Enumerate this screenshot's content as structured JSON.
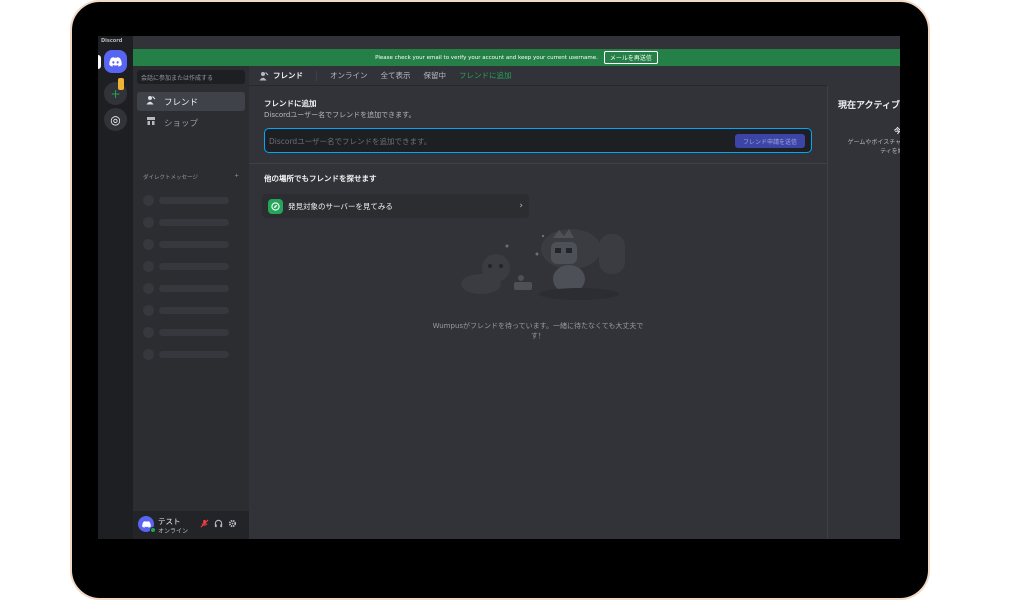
{
  "app": {
    "name": "Discord"
  },
  "banner": {
    "message": "Please check your email to verify your account and keep your current username.",
    "button_label": "メールを再送信"
  },
  "rail": {
    "add_server_symbol": "+",
    "explore_symbol": "◎"
  },
  "sidebar": {
    "search_placeholder": "会話に参加または作成する",
    "items": [
      {
        "label": "フレンド",
        "icon": "friends-icon"
      },
      {
        "label": "ショップ",
        "icon": "shop-icon"
      }
    ],
    "dm_header": "ダイレクトメッセージ",
    "dm_add": "+"
  },
  "user": {
    "name": "テスト",
    "status": "オンライン"
  },
  "header": {
    "title": "フレンド",
    "tabs": [
      "オンライン",
      "全て表示",
      "保留中"
    ],
    "add_friend_tab": "フレンドに追加"
  },
  "add_friend": {
    "title": "フレンドに追加",
    "description": "Discordユーザー名でフレンドを追加できます。",
    "input_placeholder": "Discordユーザー名でフレンドを追加できます。",
    "input_value": "",
    "send_button": "フレンド申請を送信"
  },
  "other_places": {
    "title": "他の場所でもフレンドを探せます",
    "explore_label": "発見対象のサーバーを見てみる"
  },
  "empty_state": {
    "text": "Wumpusがフレンドを待っています。一緒に待たなくても大丈夫です！"
  },
  "right_panel": {
    "title": "現在アクティブ",
    "subtitle": "今は",
    "description": "ゲームやボイスチャンネルでアクティビティを始めると"
  },
  "colors": {
    "accent": "#5865f2",
    "green": "#23a55a",
    "banner": "#248046",
    "background": "#313338"
  }
}
